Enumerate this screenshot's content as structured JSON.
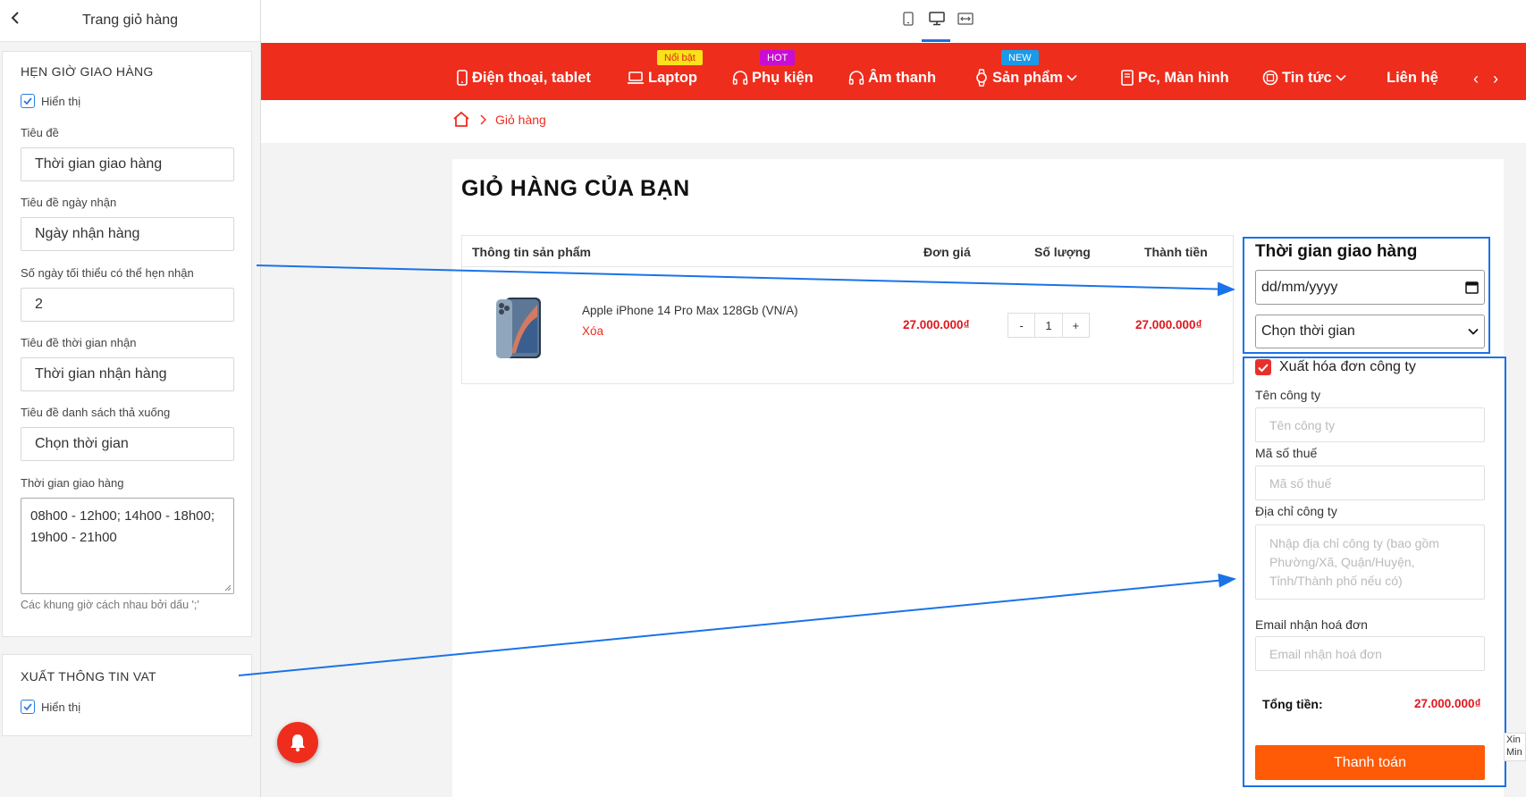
{
  "sidebar": {
    "header_title": "Trang giỏ hàng",
    "panel_delivery": {
      "title": "HẸN GIỜ GIAO HÀNG",
      "show_label": "Hiển thị",
      "fields": [
        {
          "label": "Tiêu đề",
          "value": "Thời gian giao hàng"
        },
        {
          "label": "Tiêu đề ngày nhận",
          "value": "Ngày nhận hàng"
        },
        {
          "label": "Số ngày tối thiểu có thể hẹn nhận",
          "value": "2"
        },
        {
          "label": "Tiêu đề thời gian nhận",
          "value": "Thời gian nhận hàng"
        },
        {
          "label": "Tiêu đề danh sách thả xuống",
          "value": "Chọn thời gian"
        }
      ],
      "slots_label": "Thời gian giao hàng",
      "slots_value": "08h00 - 12h00; 14h00 - 18h00; 19h00 - 21h00",
      "slots_hint": "Các khung giờ cách nhau bởi dấu ';'"
    },
    "panel_vat": {
      "title": "XUẤT THÔNG TIN VAT",
      "show_label": "Hiển thị"
    }
  },
  "nav": {
    "items": [
      {
        "label": "Điện thoại, tablet",
        "icon": "phone-icon"
      },
      {
        "label": "Laptop",
        "icon": "laptop-icon",
        "badge": "Nổi bật"
      },
      {
        "label": "Phụ kiện",
        "icon": "headphones-icon",
        "badge": "HOT"
      },
      {
        "label": "Âm thanh",
        "icon": "headphones-icon"
      },
      {
        "label": "Sản phẩm",
        "icon": "watch-icon",
        "badge": "NEW",
        "dropdown": true
      },
      {
        "label": "Pc, Màn hình",
        "icon": "monitor-icon"
      },
      {
        "label": "Tin tức",
        "icon": "news-icon",
        "dropdown": true
      },
      {
        "label": "Liên hệ"
      }
    ],
    "prev": "‹",
    "next": "›"
  },
  "breadcrumb": {
    "current": "Giỏ hàng"
  },
  "cart": {
    "title": "GIỎ HÀNG CỦA BẠN",
    "columns": {
      "product": "Thông tin sản phẩm",
      "unit_price": "Đơn giá",
      "qty": "Số lượng",
      "total": "Thành tiền"
    },
    "item": {
      "name": "Apple iPhone 14 Pro Max 128Gb (VN/A)",
      "remove": "Xóa",
      "unit_price": "27.000.000₫",
      "qty_minus": "-",
      "qty": "1",
      "qty_plus": "+",
      "total": "27.000.000₫"
    }
  },
  "delivery": {
    "title": "Thời gian giao hàng",
    "date_placeholder": "dd/mm/yyyy",
    "select_value": "Chọn thời gian"
  },
  "vat": {
    "checkbox_label": "Xuất hóa đơn công ty",
    "company_label": "Tên công ty",
    "company_placeholder": "Tên công ty",
    "tax_label": "Mã số thuế",
    "tax_placeholder": "Mã số thuế",
    "address_label": "Địa chỉ công ty",
    "address_placeholder": "Nhập địa chỉ công ty (bao gồm Phường/Xã, Quận/Huyện, Tỉnh/Thành phố nếu có)",
    "email_label": "Email nhận hoá đơn",
    "email_placeholder": "Email nhận hoá đơn"
  },
  "summary": {
    "total_label": "Tổng tiền:",
    "total_value": "27.000.000₫",
    "checkout": "Thanh toán"
  },
  "side_tab": "Xin Min",
  "colors": {
    "nav": "#ee2d1d",
    "accent_blue": "#1a73e8",
    "checkout": "#ff5a06",
    "price": "#e0171d"
  }
}
